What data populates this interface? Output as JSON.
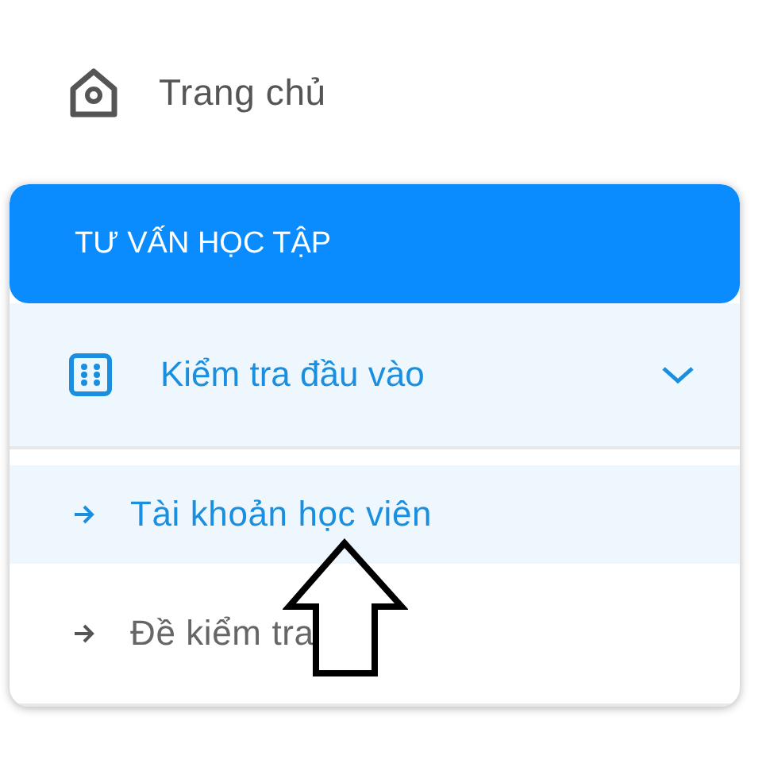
{
  "home": {
    "label": "Trang chủ"
  },
  "section": {
    "title": "TƯ VẤN HỌC TẬP",
    "groups": [
      {
        "label": "Kiểm tra đầu vào",
        "expanded": true,
        "children": [
          {
            "label": "Tài khoản học viên",
            "selected": true
          },
          {
            "label": "Đề kiểm tra",
            "selected": false
          }
        ]
      }
    ]
  },
  "annotation": {
    "kind": "up-arrow"
  }
}
